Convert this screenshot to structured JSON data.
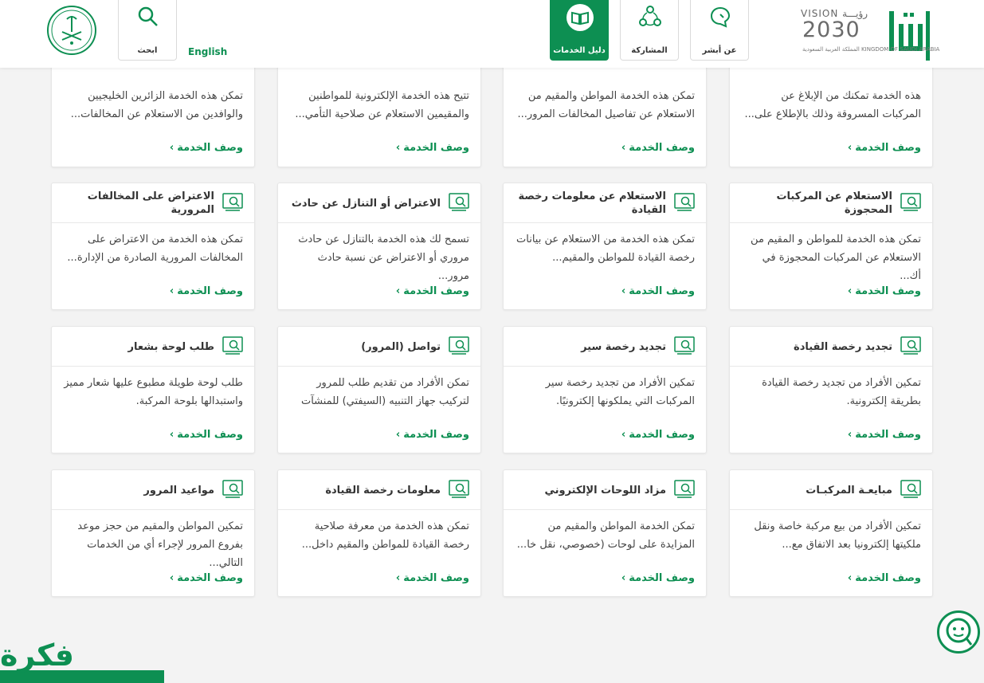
{
  "header": {
    "language_link": "English",
    "nav": [
      {
        "label": "عن أبشر",
        "icon": "chat-bubble-icon"
      },
      {
        "label": "المشاركة",
        "icon": "share-network-icon"
      },
      {
        "label": "دليل الخدمات",
        "icon": "book-icon"
      },
      {
        "label": "ابحث",
        "icon": "search-icon"
      }
    ],
    "vision": {
      "top": "VISION رؤيـــة",
      "year": "2030",
      "sub": "المملكة العربية السعودية KINGDOM OF SAUDI ARABIA"
    }
  },
  "link_label": "وصف الخدمة",
  "link_chevron": "›",
  "cards_top_partial": [
    {
      "desc": "هذه الخدمة تمكنك من الإبلاغ عن المركبات المسروقة وذلك بالإطلاع على..."
    },
    {
      "desc": "تمكن هذه الخدمة المواطن والمقيم من الاستعلام عن تفاصيل المخالفات المرور..."
    },
    {
      "desc": "تتيح هذه الخدمة الإلكترونية للمواطنين والمقيمين الاستعلام عن صلاحية التأمي..."
    },
    {
      "desc": "تمكن هذه الخدمة الزائرين الخليجيين والوافدين من الاستعلام عن المخالفات..."
    }
  ],
  "cards": [
    {
      "title": "الاستعلام عن المركبات المحجوزة",
      "desc": "تمكن هذه الخدمة للمواطن و المقيم من الاستعلام عن المركبات المحجوزة في أك..."
    },
    {
      "title": "الاستعلام عن معلومات رخصة القيادة",
      "desc": "تمكن هذه الخدمة من الاستعلام عن بيانات رخصة القيادة للمواطن والمقيم..."
    },
    {
      "title": "الاعتراض أو التنازل عن حادث",
      "desc": "تسمح لك هذه الخدمة بالتنازل عن حادث مروري أو الاعتراض عن نسبة حادث مرور..."
    },
    {
      "title": "الاعتراض على المخالفات المرورية",
      "desc": "تمكن هذه الخدمة من الاعتراض على المخالفات المرورية الصادرة من الإدارة..."
    },
    {
      "title": "تجديد رخصة القيادة",
      "desc": "تمكين الأفراد من تجديد رخصة القيادة بطريقة إلكترونية."
    },
    {
      "title": "تجديد رخصة سير",
      "desc": "تمكين الأفراد من تجديد رخصة سير المركبات التي يملكونها إلكترونيًا."
    },
    {
      "title": "تواصل (المرور)",
      "desc": "تمكن الأفراد من تقديم طلب للمرور لتركيب جهاز التنبيه (السيفتي) للمنشآت"
    },
    {
      "title": "طلب لوحة بشعار",
      "desc": "طلب لوحة طويلة مطبوع عليها شعار مميز واستبدالها بلوحة المركبة."
    },
    {
      "title": "مبايعـة المركبـات",
      "desc": "تمكين الأفراد من بيع مركبة خاصة ونقل ملكيتها إلكترونيا بعد الاتفاق مع..."
    },
    {
      "title": "مزاد اللوحات الإلكتروني",
      "desc": "تمكن الخدمة المواطن والمقيم من المزايدة على لوحات (خصوصي، نقل خا..."
    },
    {
      "title": "معلومات رخصة القيادة",
      "desc": "تمكن هذه الخدمة من معرفة صلاحية رخصة القيادة للمواطن والمقيم داخل..."
    },
    {
      "title": "مواعيد المرور",
      "desc": "تمكين المواطن والمقيم من حجز موعد بفروع المرور لإجراء أي من الخدمات التالي..."
    }
  ],
  "watermark": "فكرة",
  "colors": {
    "accent": "#0d8f52",
    "background": "#f3f3f3"
  }
}
